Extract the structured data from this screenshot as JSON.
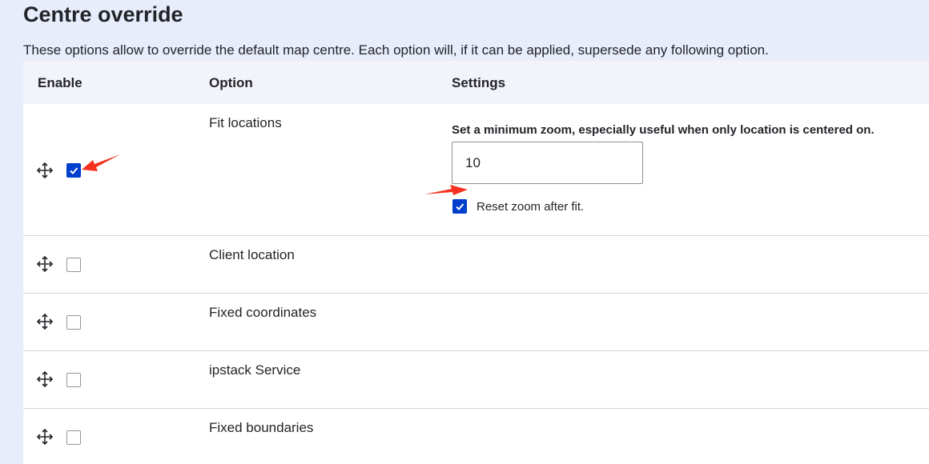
{
  "section": {
    "title": "Centre override",
    "description": "These options allow to override the default map centre. Each option will, if it can be applied, supersede any following option."
  },
  "table": {
    "headers": {
      "enable": "Enable",
      "option": "Option",
      "settings": "Settings"
    },
    "rows": [
      {
        "option": "Fit locations",
        "enabled": true
      },
      {
        "option": "Client location",
        "enabled": false
      },
      {
        "option": "Fixed coordinates",
        "enabled": false
      },
      {
        "option": "ipstack Service",
        "enabled": false
      },
      {
        "option": "Fixed boundaries",
        "enabled": false
      }
    ]
  },
  "fit_locations_settings": {
    "min_zoom_label": "Set a minimum zoom, especially useful when only location is centered on.",
    "min_zoom_value": "10",
    "reset_zoom_label": "Reset zoom after fit.",
    "reset_zoom_checked": true
  },
  "colors": {
    "checkbox_checked": "#003ecc",
    "annotation_arrow": "#f5321e",
    "page_background": "#e8edfb",
    "header_background": "#f3f4f9"
  },
  "icons": {
    "drag_handle": "move-arrows-icon",
    "check": "checkmark-icon"
  }
}
